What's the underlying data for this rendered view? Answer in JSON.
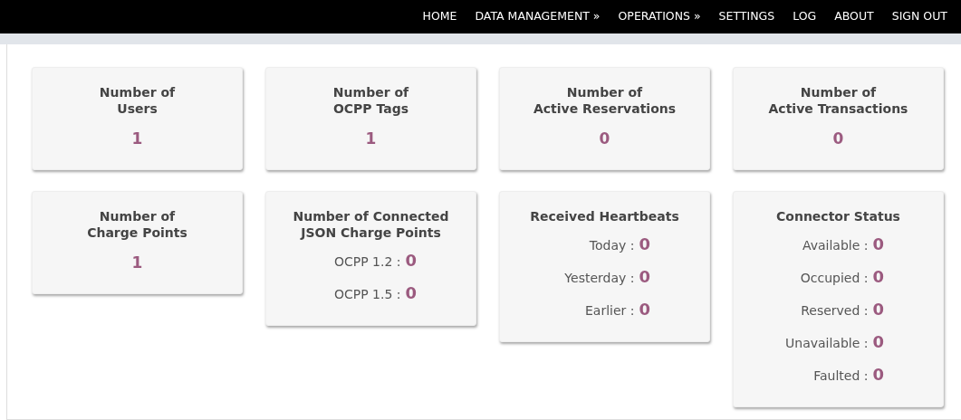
{
  "nav": [
    "HOME",
    "DATA MANAGEMENT »",
    "OPERATIONS »",
    "SETTINGS",
    "LOG",
    "ABOUT",
    "SIGN OUT"
  ],
  "columns": [
    {
      "cards": [
        {
          "kind": "count",
          "title": [
            "Number of",
            "Users"
          ],
          "value": "1"
        },
        {
          "kind": "count",
          "title": [
            "Number of",
            "Charge Points"
          ],
          "value": "1"
        }
      ]
    },
    {
      "cards": [
        {
          "kind": "count",
          "title": [
            "Number of",
            "OCPP Tags"
          ],
          "value": "1"
        },
        {
          "kind": "list",
          "title": [
            "Number of Connected",
            "JSON Charge Points"
          ],
          "rows": [
            {
              "label": "OCPP 1.2 :",
              "value": "0"
            },
            {
              "label": "OCPP 1.5 :",
              "value": "0"
            }
          ]
        }
      ]
    },
    {
      "cards": [
        {
          "kind": "count",
          "title": [
            "Number of",
            "Active Reservations"
          ],
          "value": "0"
        },
        {
          "kind": "list",
          "title": [
            "Received Heartbeats"
          ],
          "rows": [
            {
              "label": "Today :",
              "value": "0"
            },
            {
              "label": "Yesterday :",
              "value": "0"
            },
            {
              "label": "Earlier :",
              "value": "0"
            }
          ]
        }
      ]
    },
    {
      "cards": [
        {
          "kind": "count",
          "title": [
            "Number of",
            "Active Transactions"
          ],
          "value": "0"
        },
        {
          "kind": "list",
          "title": [
            "Connector Status"
          ],
          "rows": [
            {
              "label": "Available :",
              "value": "0"
            },
            {
              "label": "Occupied :",
              "value": "0"
            },
            {
              "label": "Reserved :",
              "value": "0"
            },
            {
              "label": "Unavailable :",
              "value": "0"
            },
            {
              "label": "Faulted :",
              "value": "0"
            }
          ]
        }
      ]
    }
  ]
}
